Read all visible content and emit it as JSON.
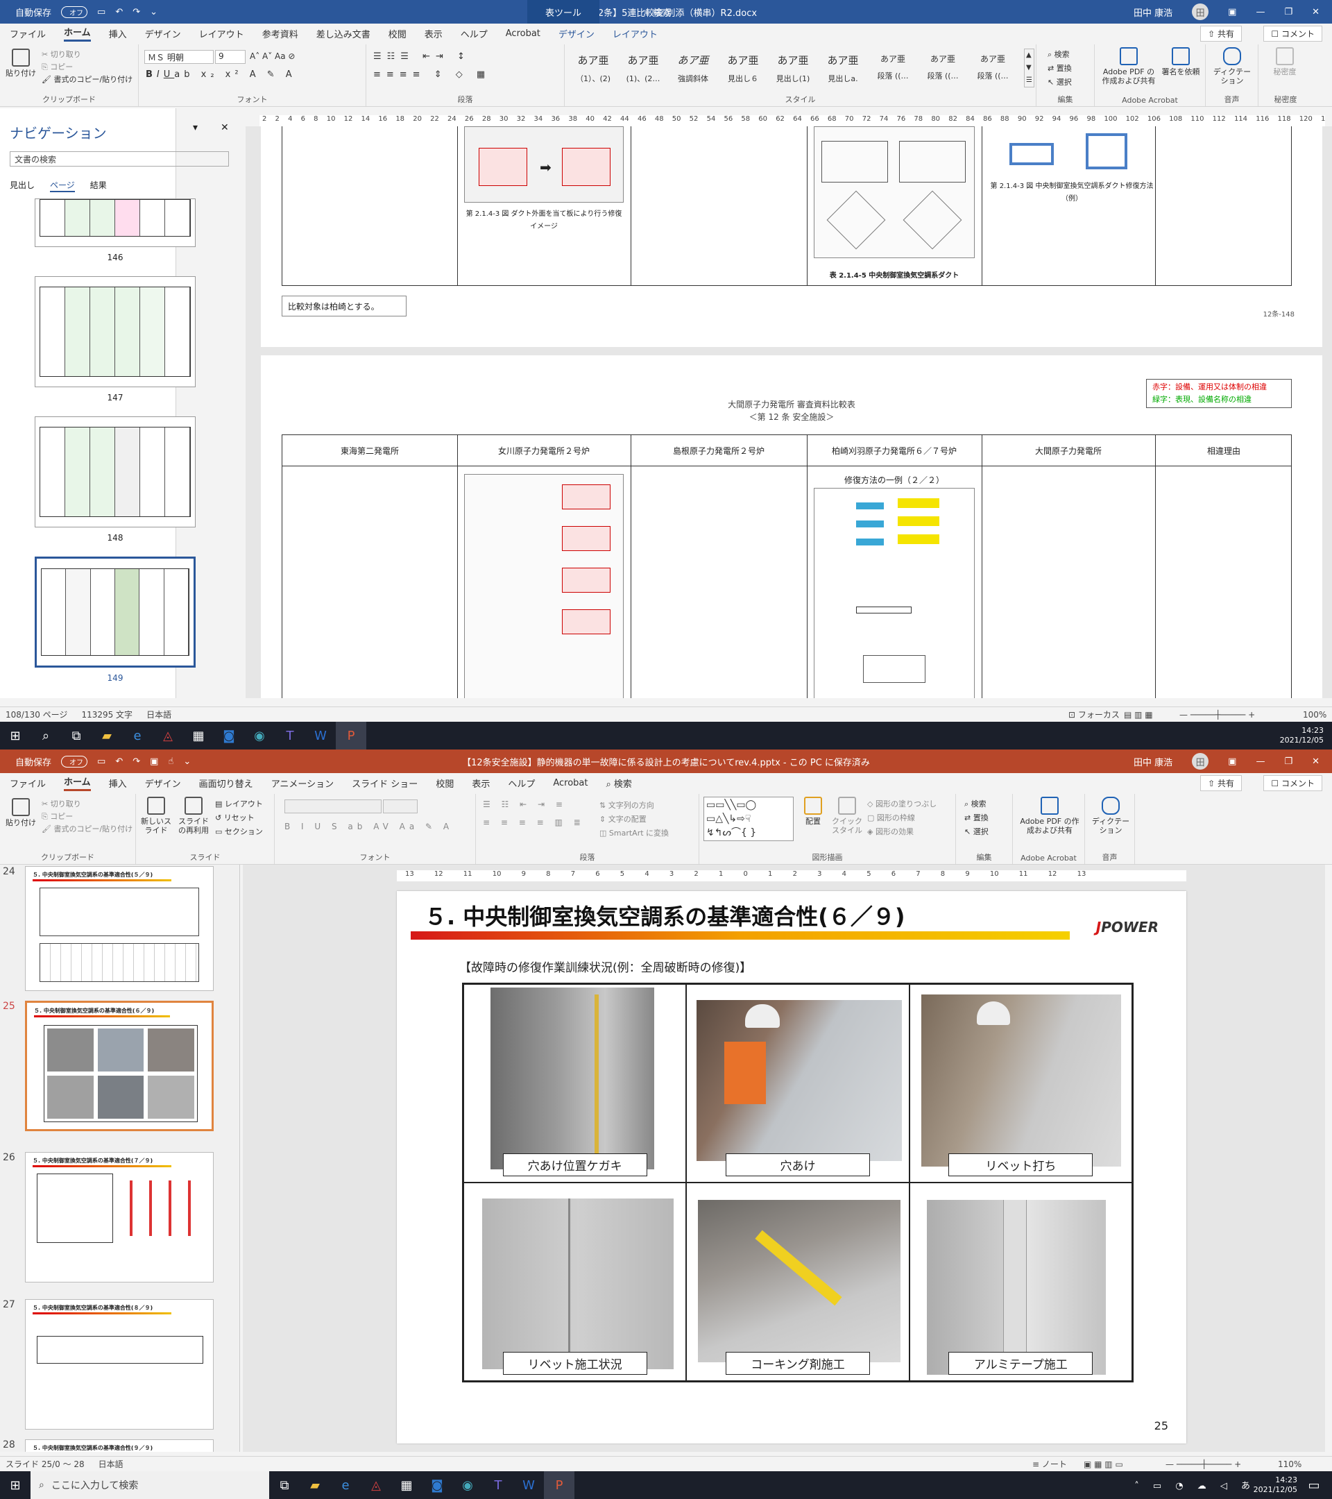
{
  "word": {
    "title": "②【12条】5連比較表 別添（横串）R2.docx",
    "autosave_label": "自動保存",
    "autosave_state": "オフ",
    "context_tab": "表ツール",
    "search_label": "検索",
    "user": "田中 康浩",
    "avatar_initial": "田",
    "menu": [
      "ファイル",
      "ホーム",
      "挿入",
      "デザイン",
      "レイアウト",
      "参考資料",
      "差し込み文書",
      "校閲",
      "表示",
      "ヘルプ",
      "Acrobat",
      "デザイン",
      "レイアウト"
    ],
    "share": "共有",
    "comment": "コメント",
    "ribbon": {
      "paste": "貼り付け",
      "cut": "切り取り",
      "copy": "コピー",
      "format_painter": "書式のコピー/貼り付け",
      "clipboard": "クリップボード",
      "font_name": "ＭＳ 明朝",
      "font_size": "9",
      "font_group": "フォント",
      "paragraph_group": "段落",
      "styles_group": "スタイル",
      "styles": [
        {
          "sample": "あア亜",
          "name": "（1）、(2)"
        },
        {
          "sample": "あア亜",
          "name": "(1)、(2…"
        },
        {
          "sample": "あア亜",
          "name": "強調斜体"
        },
        {
          "sample": "あア亜",
          "name": "見出し６"
        },
        {
          "sample": "あア亜",
          "name": "見出し(1)"
        },
        {
          "sample": "あア亜",
          "name": "見出しa."
        },
        {
          "sample": "あア亜",
          "name": "段落 ((…"
        },
        {
          "sample": "あア亜",
          "name": "段落 ((…"
        },
        {
          "sample": "あア亜",
          "name": "段落 ((…"
        }
      ],
      "find": "検索",
      "replace": "置換",
      "select": "選択",
      "edit_group": "編集",
      "acrobat_btn1": "Adobe PDF の作成および共有",
      "acrobat_btn2": "署名を依頼",
      "acrobat_group": "Adobe Acrobat",
      "dictation": "ディクテーション",
      "voice_group": "音声",
      "sensitivity": "秘密度",
      "sensitivity_group": "秘密度"
    },
    "nav": {
      "title": "ナビゲーション",
      "search_placeholder": "文書の検索",
      "tabs": [
        "見出し",
        "ページ",
        "結果"
      ],
      "pages": [
        "146",
        "147",
        "148",
        "149"
      ]
    },
    "ruler_text": "2 2 4 6 8 10 12 14 16 18 20 22 24 26 28 30 32 34 36 38 40 42 44 46 48 50 52 54 56 58 60 62 64 66 68 70 72 74 76 78 80 82 84 86 88 90 92 94 96 98 100 102 106 108 110 112 114 116 118 120 122",
    "doc": {
      "caption1": "第 2.1.4-3 図 ダクト外面を当て板により行う修復イメージ",
      "caption2": "表 2.1.4-5 中央制御室換気空調系ダクト",
      "caption3": "第 2.1.4-3 図 中央制御室換気空調系ダクト修復方法（例）",
      "note": "比較対象は柏崎とする。",
      "page_ref": "12条-148",
      "header_line1": "大間原子力発電所 審査資料比較表",
      "header_line2": "＜第 12 条 安全施設＞",
      "legend_red": "赤字：設備、運用又は体制の相違",
      "legend_green": "緑字：表現、設備名称の相違",
      "columns": [
        "東海第二発電所",
        "女川原子力発電所２号炉",
        "島根原子力発電所２号炉",
        "柏崎刈羽原子力発電所６／７号炉",
        "大間原子力発電所",
        "相違理由"
      ],
      "repair_example": "修復方法の一例（２／２）"
    },
    "status": {
      "pages": "108/130 ページ",
      "words": "113295 文字",
      "lang": "日本語",
      "focus": "フォーカス",
      "zoom": "100%"
    }
  },
  "taskbar_top": {
    "time": "14:23",
    "date": "2021/12/05"
  },
  "ppt": {
    "title": "【12条安全施設】静的機器の単一故障に係る設計上の考慮についてrev.4.pptx - この PC に保存済み",
    "autosave_label": "自動保存",
    "autosave_state": "オフ",
    "user": "田中 康浩",
    "avatar_initial": "田",
    "menu": [
      "ファイル",
      "ホーム",
      "挿入",
      "デザイン",
      "画面切り替え",
      "アニメーション",
      "スライド ショー",
      "校閲",
      "表示",
      "ヘルプ",
      "Acrobat",
      "検索"
    ],
    "share": "共有",
    "comment": "コメント",
    "ribbon": {
      "paste": "貼り付け",
      "cut": "切り取り",
      "copy": "コピー",
      "format_painter": "書式のコピー/貼り付け",
      "clipboard": "クリップボード",
      "new_slide": "新しいスライド",
      "reuse_slide": "スライドの再利用",
      "layout": "レイアウト",
      "reset": "リセット",
      "section": "セクション",
      "slides_group": "スライド",
      "font_group": "フォント",
      "text_direction": "文字列の方向",
      "text_align": "文字の配置",
      "smartart": "SmartArt に変換",
      "paragraph_group": "段落",
      "arrange": "配置",
      "quick_style": "クイックスタイル",
      "shape_fill": "図形の塗りつぶし",
      "shape_outline": "図形の枠線",
      "shape_effect": "図形の効果",
      "drawing_group": "図形描画",
      "find": "検索",
      "replace": "置換",
      "select": "選択",
      "edit_group": "編集",
      "acrobat_btn": "Adobe PDF の作成および共有",
      "acrobat_group": "Adobe Acrobat",
      "dictation": "ディクテーション",
      "voice_group": "音声"
    },
    "thumbs": [
      {
        "num": "24",
        "title": "５. 中央制御室換気空調系の基準適合性(５／９)"
      },
      {
        "num": "25",
        "title": "５. 中央制御室換気空調系の基準適合性(６／９)"
      },
      {
        "num": "26",
        "title": "５. 中央制御室換気空調系の基準適合性(７／９)"
      },
      {
        "num": "27",
        "title": "５. 中央制御室換気空調系の基準適合性(８／９)"
      },
      {
        "num": "28",
        "title": "５. 中央制御室換気空調系の基準適合性(９／９)"
      }
    ],
    "ruler_text": "13 12 11 10 9 8 7 6 5 4 3 2 1 0 1 2 3 4 5 6 7 8 9 10 11 12 13",
    "slide": {
      "title": "５. 中央制御室換気空調系の基準適合性(６／９)",
      "logo": "POWER",
      "subtitle": "【故障時の修復作業訓練状況(例：全周破断時の修復)】",
      "captions": [
        "穴あけ位置ケガキ",
        "穴あけ",
        "リベット打ち",
        "リベット施工状況",
        "コーキング剤施工",
        "アルミテープ施工"
      ],
      "page": "25"
    },
    "status": {
      "slide": "スライド 25/0 ～ 28",
      "lang": "日本語",
      "notes": "ノート",
      "zoom": "110%"
    }
  },
  "taskbar_bottom": {
    "search_placeholder": "ここに入力して検索",
    "time": "14:23",
    "date": "2021/12/05",
    "ime": "あ"
  }
}
